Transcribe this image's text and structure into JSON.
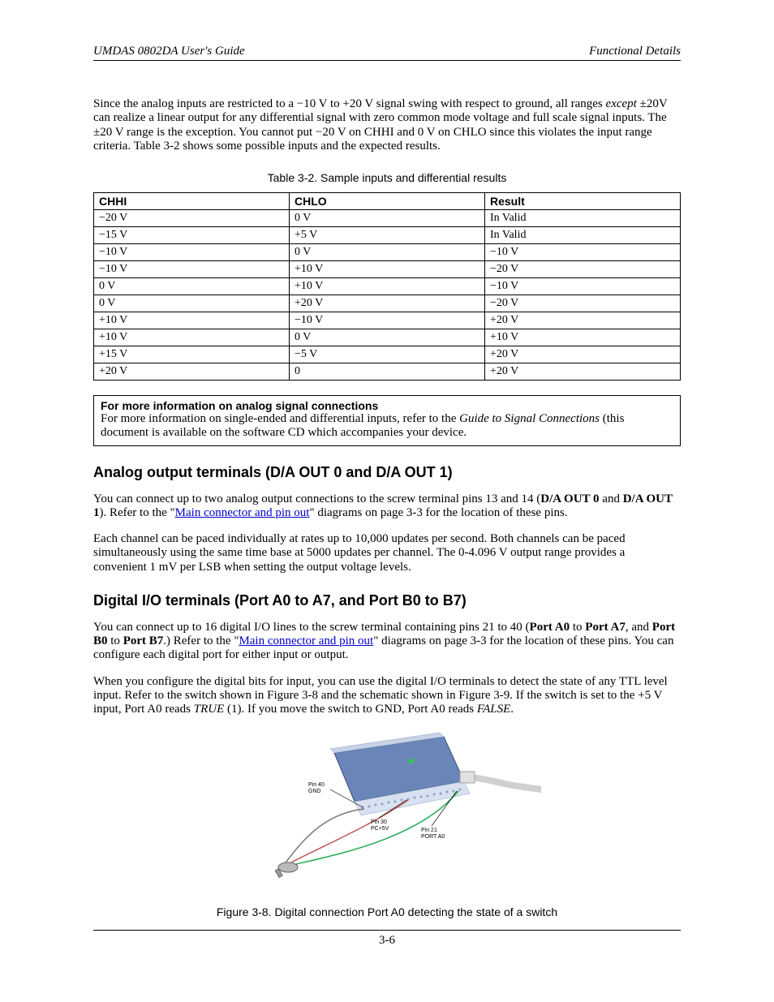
{
  "header": {
    "left": "UMDAS 0802DA User's Guide",
    "right": "Functional Details"
  },
  "intro": {
    "span1": "Since the analog inputs are restricted to a −10 V to +20 V signal swing with respect to ground, all ranges ",
    "except": "except",
    "span2": " ±20V can realize a linear output for any differential signal with zero common mode voltage and full scale signal inputs. The ±20 V range is the exception. You cannot put −20 V on CHHI and 0 V on CHLO since this violates the input range criteria. Table 3-2 shows some possible inputs and the expected results."
  },
  "table": {
    "caption": "Table 3-2. Sample inputs and differential results",
    "headers": [
      "CHHI",
      "CHLO",
      "Result"
    ],
    "rows": [
      [
        "−20 V",
        "0 V",
        "In Valid"
      ],
      [
        "−15 V",
        "+5 V",
        "In Valid"
      ],
      [
        "−10 V",
        "0 V",
        "−10 V"
      ],
      [
        "−10 V",
        "+10 V",
        "−20 V"
      ],
      [
        "0 V",
        "+10 V",
        "−10 V"
      ],
      [
        "0 V",
        "+20 V",
        "−20 V"
      ],
      [
        "+10 V",
        "−10 V",
        "+20 V"
      ],
      [
        "+10 V",
        "0 V",
        "+10 V"
      ],
      [
        "+15 V",
        "−5 V",
        "+20 V"
      ],
      [
        "+20 V",
        "0",
        "+20 V"
      ]
    ]
  },
  "info_box": {
    "title": "For more information on analog signal connections",
    "pre_italic": "For more information on single-ended and differential inputs, refer to the ",
    "italic": "Guide to Signal Connections",
    "post_italic": " (this document is available on the software CD which accompanies your device."
  },
  "section_analog": {
    "title": "Analog output terminals (D/A OUT 0 and D/A OUT 1)",
    "p1_pre": "You can connect up to two analog output connections to the screw terminal pins 13 and 14 (",
    "p1_b1": "D/A OUT 0",
    "p1_mid": " and ",
    "p1_b2": "D/A OUT 1",
    "p1_after_b2": "). Refer to the \"",
    "p1_link": "Main connector and pin out",
    "p1_post_link": "\" diagrams on page 3-3 for the location of these pins.",
    "p2": "Each channel can be paced individually at rates up to 10,000 updates per second. Both channels can be paced simultaneously using the same time base at 5000 updates per channel. The 0-4.096 V output range provides a convenient 1 mV per LSB when setting the output voltage levels."
  },
  "section_digital": {
    "title": "Digital I/O terminals (Port A0 to A7, and Port B0 to B7)",
    "p1_pre": "You can connect up to 16 digital I/O lines to the screw terminal containing pins 21 to 40 (",
    "p1_b1": "Port A0",
    "p1_mid1": " to ",
    "p1_b2": "Port A7",
    "p1_mid2": ", and ",
    "p1_b3": "Port B0",
    "p1_mid3": " to ",
    "p1_b4": "Port B7",
    "p1_after_b4": ".) Refer to the \"",
    "p1_link": "Main connector and pin out",
    "p1_post_link": "\" diagrams on page 3-3 for the location of these pins. You can configure each digital port for either input or output.",
    "p2_pre": "When you configure the digital bits for input, you can use the digital I/O terminals to detect the state of any TTL level input. Refer to the switch shown in Figure 3-8 and the schematic shown in Figure 3-9. If the switch is set to the +5 V input, Port A0 reads ",
    "p2_true": "TRUE",
    "p2_mid": " (1). If you move the switch to GND, Port A0 reads ",
    "p2_false": "FALSE",
    "p2_post": "."
  },
  "figure": {
    "caption": "Figure 3-8. Digital connection Port A0 detecting the state of a switch",
    "labels": {
      "pin40a": "Pin 40",
      "pin40b": "GND",
      "pin30a": "Pin 30",
      "pin30b": "PC+5V",
      "pin21a": "Pin 21",
      "pin21b": "PORT A0"
    }
  },
  "footer": {
    "page": "3-6"
  }
}
